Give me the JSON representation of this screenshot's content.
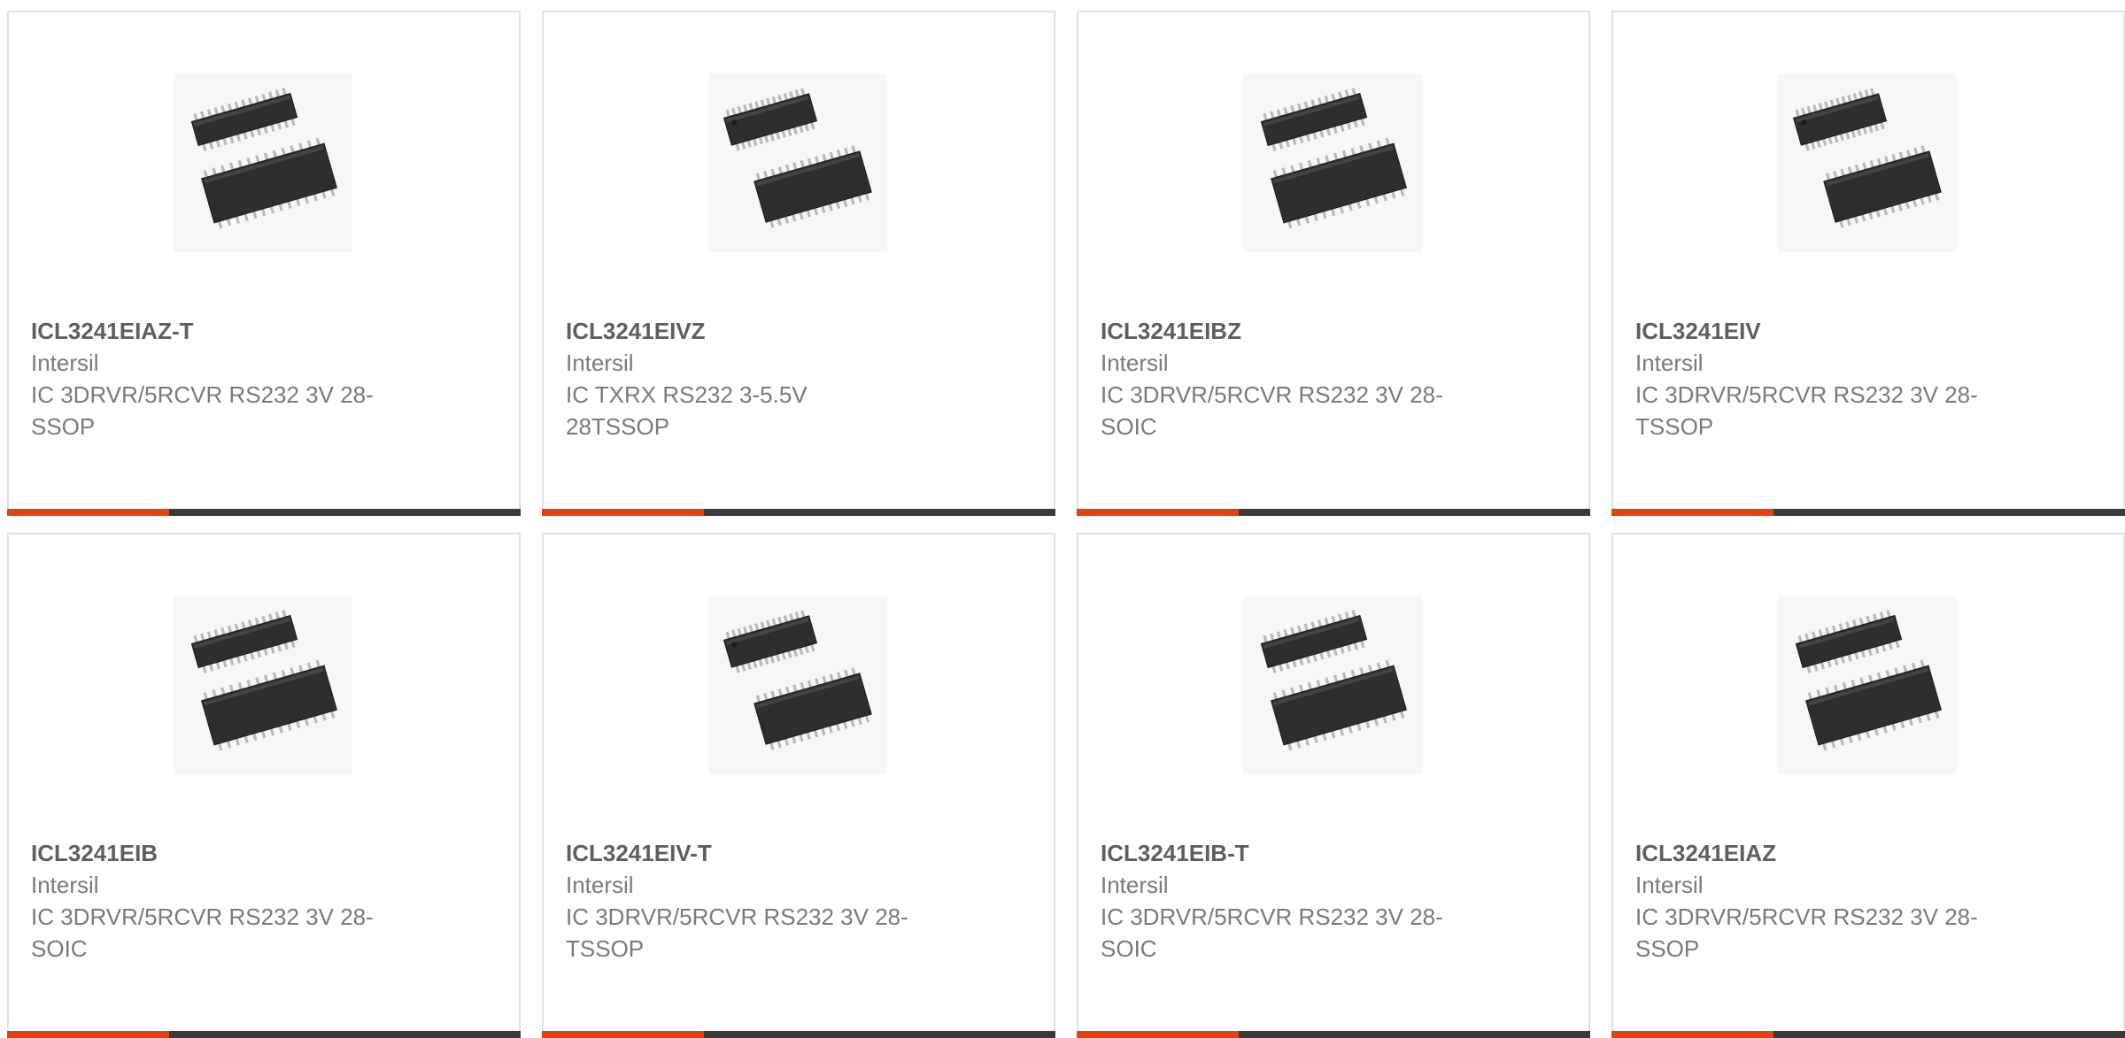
{
  "theme": {
    "accent": "#e8410d",
    "bar": "#3a3a3a",
    "border": "#e2e2e2",
    "title": "#5f5f5f",
    "text": "#7a7a7a"
  },
  "products": [
    {
      "part_number": "ICL3241EIAZ-T",
      "manufacturer": "Intersil",
      "desc_line1": "IC 3DRVR/5RCVR RS232 3V 28-",
      "desc_line2": "SSOP",
      "image": "ssop-chip-pair-icon"
    },
    {
      "part_number": "ICL3241EIVZ",
      "manufacturer": "Intersil",
      "desc_line1": "IC TXRX RS232 3-5.5V",
      "desc_line2": "28TSSOP",
      "image": "tssop-chip-pair-icon"
    },
    {
      "part_number": "ICL3241EIBZ",
      "manufacturer": "Intersil",
      "desc_line1": "IC 3DRVR/5RCVR RS232 3V 28-",
      "desc_line2": "SOIC",
      "image": "soic-chip-pair-icon"
    },
    {
      "part_number": "ICL3241EIV",
      "manufacturer": "Intersil",
      "desc_line1": "IC 3DRVR/5RCVR RS232 3V 28-",
      "desc_line2": "TSSOP",
      "image": "tssop-chip-pair-icon"
    },
    {
      "part_number": "ICL3241EIB",
      "manufacturer": "Intersil",
      "desc_line1": "IC 3DRVR/5RCVR RS232 3V 28-",
      "desc_line2": "SOIC",
      "image": "soic-chip-pair-icon"
    },
    {
      "part_number": "ICL3241EIV-T",
      "manufacturer": "Intersil",
      "desc_line1": "IC 3DRVR/5RCVR RS232 3V 28-",
      "desc_line2": "TSSOP",
      "image": "tssop-chip-pair-icon"
    },
    {
      "part_number": "ICL3241EIB-T",
      "manufacturer": "Intersil",
      "desc_line1": "IC 3DRVR/5RCVR RS232 3V 28-",
      "desc_line2": "SOIC",
      "image": "soic-chip-pair-icon"
    },
    {
      "part_number": "ICL3241EIAZ",
      "manufacturer": "Intersil",
      "desc_line1": "IC 3DRVR/5RCVR RS232 3V 28-",
      "desc_line2": "SSOP",
      "image": "ssop-chip-pair-icon"
    }
  ]
}
